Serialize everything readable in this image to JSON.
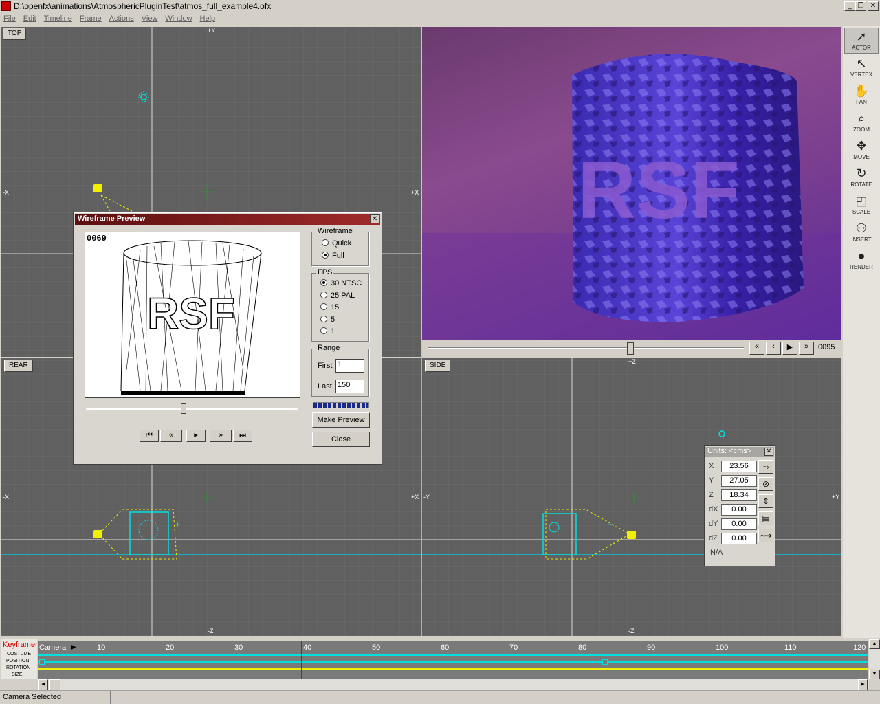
{
  "window": {
    "title": "D:\\openfx\\animations\\AtmosphericPluginTest\\atmos_full_example4.ofx",
    "minimize": "_",
    "restore": "❐",
    "close": "✕"
  },
  "menu": [
    "File",
    "Edit",
    "Timeline",
    "Frame",
    "Actions",
    "View",
    "Window",
    "Help"
  ],
  "viewports": {
    "top": {
      "label": "TOP",
      "axis_top": "+Y",
      "axis_left": "-X",
      "axis_right": "+X"
    },
    "rear": {
      "label": "REAR",
      "axis_left": "-X",
      "axis_right": "+X",
      "axis_bottom": "-Z"
    },
    "side": {
      "label": "SIDE",
      "axis_top": "+Z",
      "axis_left": "-Y",
      "axis_right": "+Y",
      "axis_bottom": "-Z"
    },
    "camera": {
      "frame_counter": "0095",
      "slider_position": 0.63
    }
  },
  "tools": [
    {
      "label": "ACTOR",
      "key": "O",
      "icon": "cursor-arrow-icon"
    },
    {
      "label": "VERTEX",
      "key": "V",
      "icon": "vertex-arrow-icon"
    },
    {
      "label": "PAN",
      "key": "P",
      "icon": "hand-icon"
    },
    {
      "label": "ZOOM",
      "key": "Z",
      "icon": "magnifier-icon"
    },
    {
      "label": "MOVE",
      "key": "M",
      "icon": "move-arrows-icon"
    },
    {
      "label": "ROTATE",
      "key": "R",
      "icon": "rotate-icon"
    },
    {
      "label": "SCALE",
      "key": "S",
      "icon": "scale-icon"
    },
    {
      "label": "INSERT",
      "key": "",
      "icon": "insert-icon"
    },
    {
      "label": "RENDER",
      "key": "",
      "icon": "render-icon"
    }
  ],
  "wireframe_preview": {
    "title": "Wireframe Preview",
    "frame": "0069",
    "preview_text": "RSF",
    "wireframe_group": "Wireframe",
    "wireframe_options": [
      {
        "label": "Quick",
        "selected": false
      },
      {
        "label": "Full",
        "selected": true
      }
    ],
    "fps_group": "FPS",
    "fps_options": [
      {
        "label": "30 NTSC",
        "selected": true
      },
      {
        "label": "25 PAL",
        "selected": false
      },
      {
        "label": "15",
        "selected": false
      },
      {
        "label": "5",
        "selected": false
      },
      {
        "label": "1",
        "selected": false
      }
    ],
    "range_group": "Range",
    "first_label": "First",
    "first_value": "1",
    "last_label": "Last",
    "last_value": "150",
    "make_preview": "Make Preview",
    "close": "Close",
    "slider_position": 0.46
  },
  "units_panel": {
    "title": "Units: <cms>",
    "fields": [
      {
        "label": "X",
        "value": "23.56"
      },
      {
        "label": "Y",
        "value": "27.05"
      },
      {
        "label": "Z",
        "value": "18.34"
      },
      {
        "label": "dX",
        "value": "0.00"
      },
      {
        "label": "dY",
        "value": "0.00"
      },
      {
        "label": "dZ",
        "value": "0.00"
      }
    ],
    "status": "N/A"
  },
  "timeline": {
    "title": "Keyframer",
    "tracks": [
      "COSTUME",
      "POSITION",
      "ROTATION",
      "SIZE"
    ],
    "actor": "Camera",
    "ticks": [
      "10",
      "20",
      "30",
      "40",
      "50",
      "60",
      "70",
      "80",
      "90",
      "100",
      "110",
      "120"
    ]
  },
  "status": "Camera Selected",
  "colors": {
    "viewport_bg": "#606060",
    "grid": "#707070",
    "cyan": "#00e0e0",
    "yellow": "#f0f000",
    "titlebar": "#7a1414"
  }
}
